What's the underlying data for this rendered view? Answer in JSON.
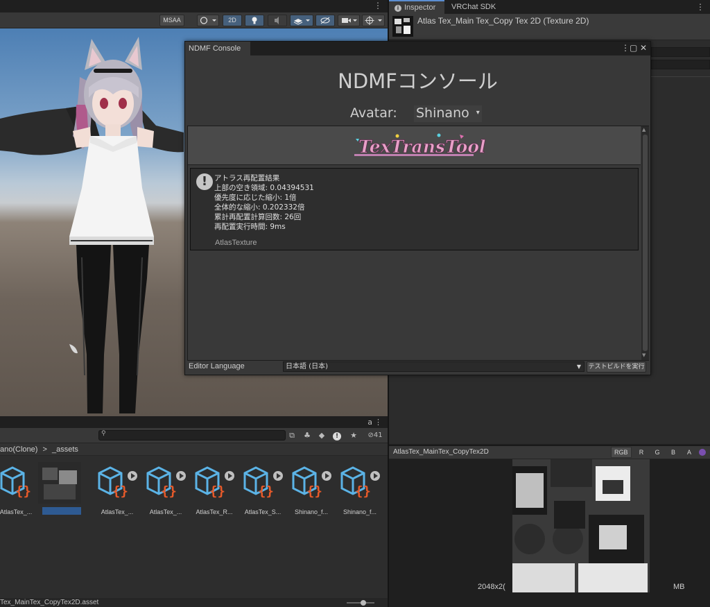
{
  "scene": {
    "toolbar": {
      "msaa": "MSAA",
      "two_d": "2D"
    }
  },
  "inspector": {
    "tabs": [
      {
        "label": "Inspector"
      },
      {
        "label": "VRChat SDK"
      }
    ],
    "title": "Atlas Tex_Main Tex_Copy Tex 2D (Texture 2D)"
  },
  "preview": {
    "title": "AtlasTex_MainTex_CopyTex2D",
    "channels": [
      "RGB",
      "R",
      "G",
      "B",
      "A"
    ],
    "info_left": "2048x2(",
    "info_right": "MB"
  },
  "project": {
    "hidden_count": "41",
    "breadcrumb": {
      "parent": "ano(Clone)",
      "separator": ">",
      "current": "_assets"
    },
    "assets": [
      {
        "label": "AtlasTex_..."
      },
      {
        "label": ""
      },
      {
        "label": "AtlasTex_..."
      },
      {
        "label": "AtlasTex_..."
      },
      {
        "label": "AtlasTex_R..."
      },
      {
        "label": "AtlasTex_S..."
      },
      {
        "label": "Shinano_f..."
      },
      {
        "label": "Shinano_f..."
      }
    ],
    "status_path": "Tex_MainTex_CopyTex2D.asset"
  },
  "ndmf": {
    "tab_label": "NDMF Console",
    "heading": "NDMFコンソール",
    "avatar_label": "Avatar:",
    "avatar_value": "Shinano",
    "message": {
      "lines": [
        "アトラス再配置結果",
        "上部の空き領域: 0.04394531",
        "優先度に応じた縮小: 1倍",
        "全体的な縮小: 0.202332倍",
        "累計再配置計算回数: 26回",
        "再配置実行時間: 9ms"
      ],
      "source": "AtlasTexture"
    },
    "footer": {
      "language_label": "Editor Language",
      "language_value": "日本語 (日本)",
      "test_build_label": "テストビルドを実行"
    }
  }
}
